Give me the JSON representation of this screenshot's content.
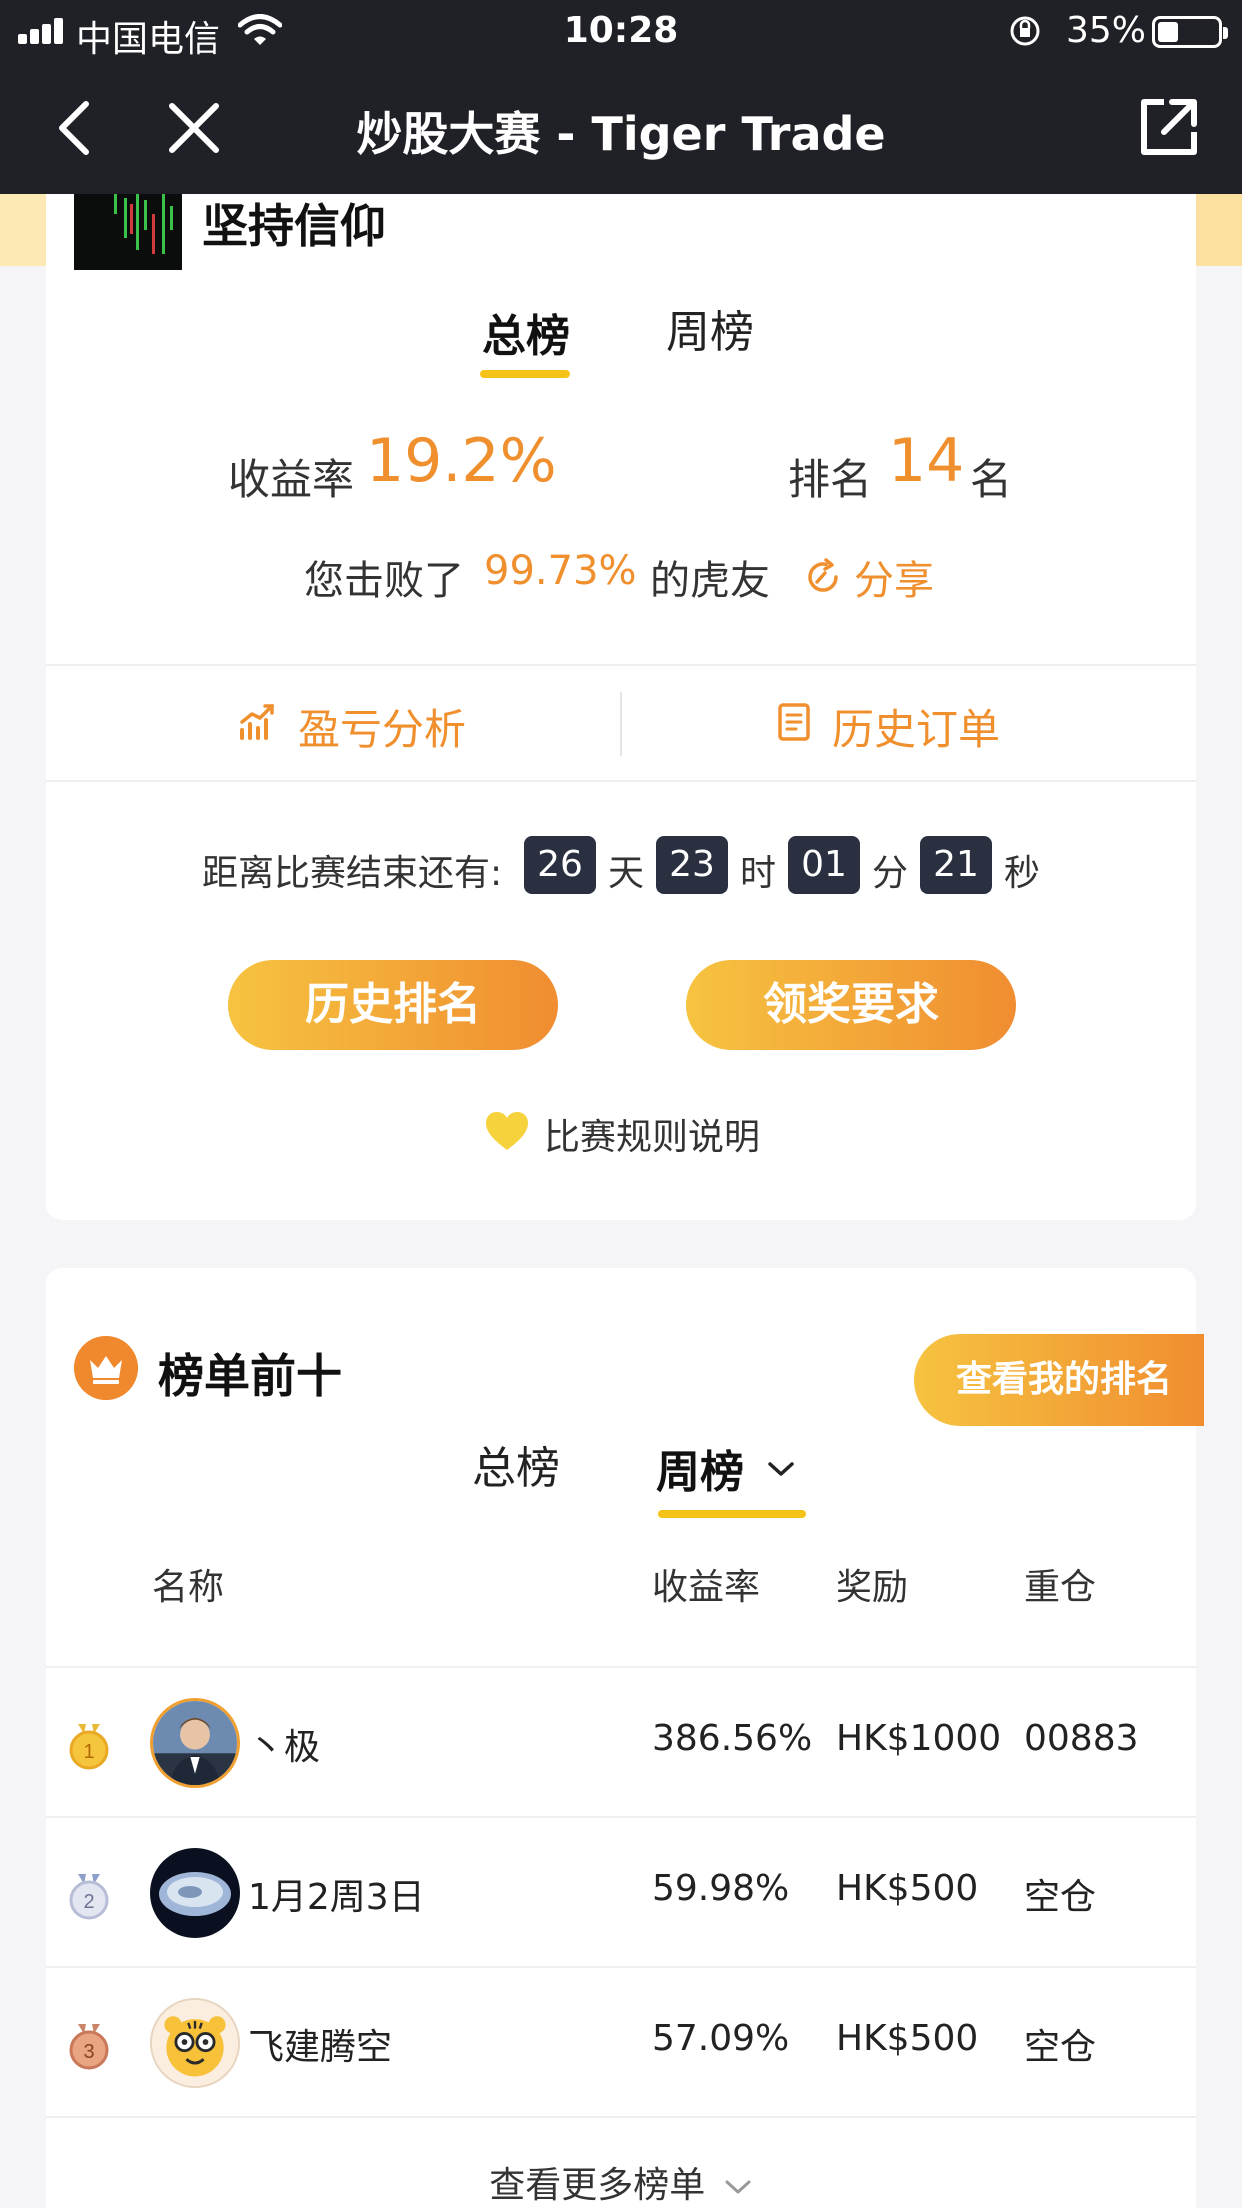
{
  "status_bar": {
    "carrier": "中国电信",
    "time": "10:28",
    "battery_percent": "35%"
  },
  "nav": {
    "title": "炒股大赛 - Tiger Trade"
  },
  "profile": {
    "name": "坚持信仰"
  },
  "top_tabs": [
    {
      "label": "总榜",
      "active": true
    },
    {
      "label": "周榜",
      "active": false
    }
  ],
  "stats": {
    "return_label": "收益率",
    "return_value": "19.2%",
    "rank_label": "排名",
    "rank_value": "14",
    "rank_unit": "名"
  },
  "beat": {
    "prefix": "您击败了",
    "percent": "99.73%",
    "suffix": "的虎友",
    "share_label": "分享"
  },
  "actions": {
    "pnl_label": "盈亏分析",
    "orders_label": "历史订单"
  },
  "countdown": {
    "label": "距离比赛结束还有:",
    "days": "26",
    "days_unit": "天",
    "hours": "23",
    "hours_unit": "时",
    "minutes": "01",
    "minutes_unit": "分",
    "seconds": "21",
    "seconds_unit": "秒"
  },
  "buttons": {
    "history_rank": "历史排名",
    "prize_requirements": "领奖要求"
  },
  "rules_label": "比赛规则说明",
  "leaderboard": {
    "title": "榜单前十",
    "my_rank_button": "查看我的排名",
    "tabs": [
      {
        "label": "总榜",
        "active": false
      },
      {
        "label": "周榜",
        "active": true
      }
    ],
    "columns": [
      "名称",
      "收益率",
      "奖励",
      "重仓"
    ],
    "rows": [
      {
        "rank": "1",
        "name": "丶极",
        "return": "386.56%",
        "reward": "HK$1000",
        "position": "00883"
      },
      {
        "rank": "2",
        "name": "1月2周3日",
        "return": "59.98%",
        "reward": "HK$500",
        "position": "空仓"
      },
      {
        "rank": "3",
        "name": "飞建腾空",
        "return": "57.09%",
        "reward": "HK$500",
        "position": "空仓"
      }
    ],
    "more_label": "查看更多榜单"
  },
  "colors": {
    "accent_orange": "#f08f2e",
    "tab_underline": "#f5c318",
    "dark_header": "#1f2127",
    "countdown_box": "#2a3040"
  }
}
